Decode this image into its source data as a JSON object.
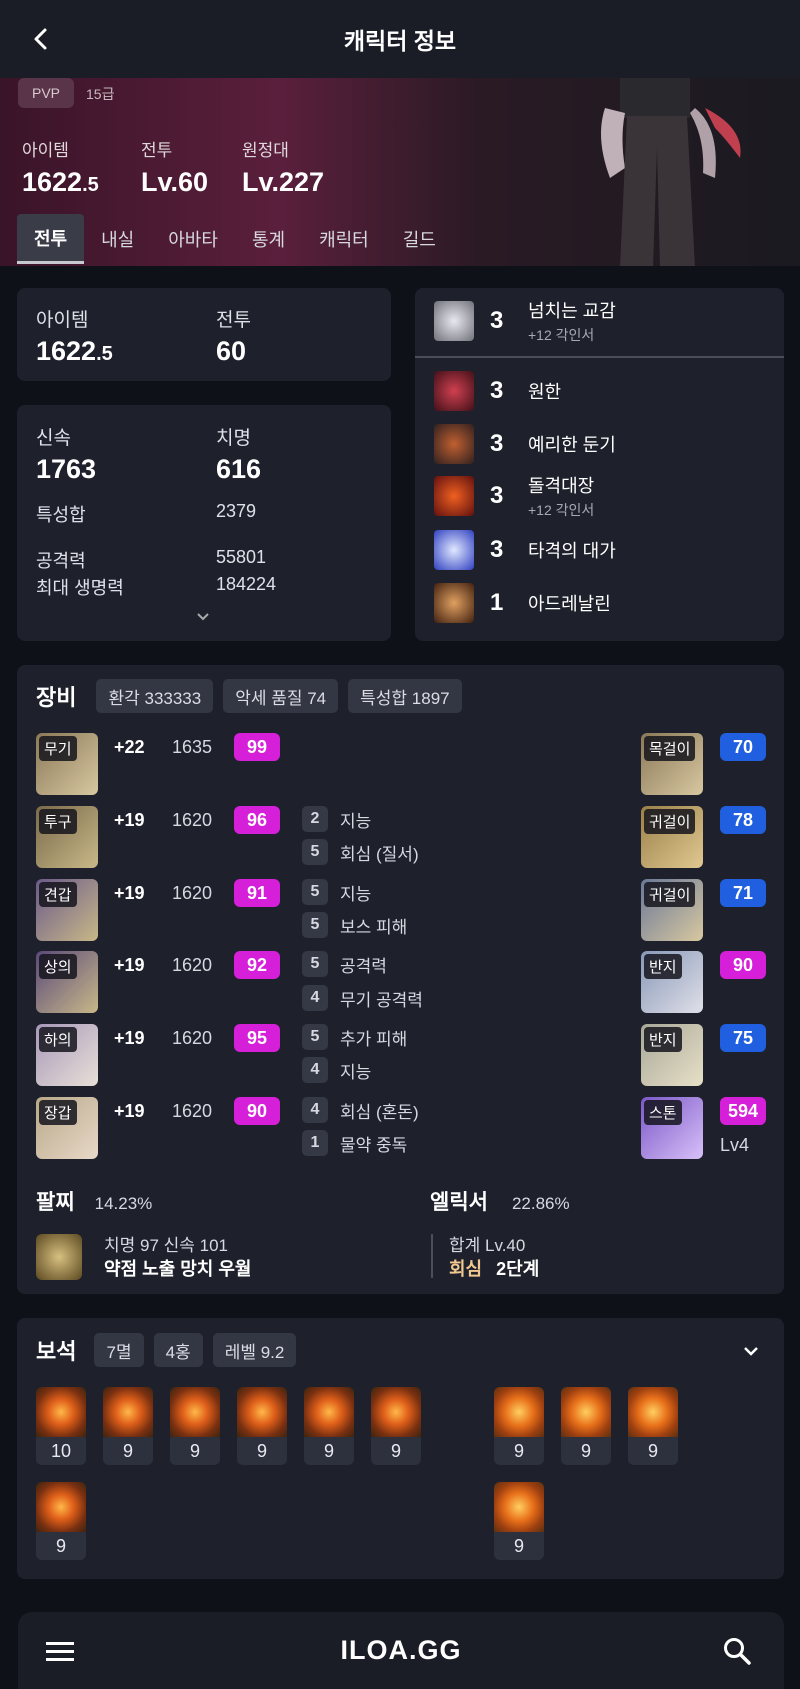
{
  "header": {
    "title": "캐릭터 정보"
  },
  "hero": {
    "pvp_label": "PVP",
    "grade": "15급",
    "stats": [
      {
        "label": "아이템",
        "value_main": "1622",
        "value_small": ".5"
      },
      {
        "label": "전투",
        "value_main": "Lv.60",
        "value_small": ""
      },
      {
        "label": "원정대",
        "value_main": "Lv.227",
        "value_small": ""
      }
    ]
  },
  "tabs": [
    "전투",
    "내실",
    "아바타",
    "통계",
    "캐릭터",
    "길드"
  ],
  "summary": {
    "item_label": "아이템",
    "item_main": "1622",
    "item_small": ".5",
    "combat_label": "전투",
    "combat_value": "60"
  },
  "stats": {
    "swift_label": "신속",
    "swift_value": "1763",
    "crit_label": "치명",
    "crit_value": "616",
    "trait_label": "특성합",
    "trait_value": "2379",
    "atk_label": "공격력",
    "atk_value": "55801",
    "hp_label": "최대 생명력",
    "hp_value": "184224"
  },
  "engravings": [
    {
      "level": "3",
      "name": "넘치는 교감",
      "sub": "+12 각인서",
      "icon": "engraving-icon",
      "color": "#c0c0c8"
    },
    {
      "level": "3",
      "name": "원한",
      "sub": "",
      "icon": "engraving-icon",
      "color": "#a03040"
    },
    {
      "level": "3",
      "name": "예리한 둔기",
      "sub": "",
      "icon": "engraving-icon",
      "color": "#804020"
    },
    {
      "level": "3",
      "name": "돌격대장",
      "sub": "+12 각인서",
      "icon": "engraving-icon",
      "color": "#c04010"
    },
    {
      "level": "3",
      "name": "타격의 대가",
      "sub": "",
      "icon": "engraving-icon",
      "color": "#4050e0"
    },
    {
      "level": "1",
      "name": "아드레날린",
      "sub": "",
      "icon": "engraving-icon",
      "color": "#a06030"
    }
  ],
  "equipment": {
    "title": "장비",
    "chips": [
      "환각 333333",
      "악세 품질 74",
      "특성합 1897"
    ],
    "items": [
      {
        "slot": "무기",
        "plus": "+22",
        "level": "1635",
        "quality": "99",
        "opts": []
      },
      {
        "slot": "투구",
        "plus": "+19",
        "level": "1620",
        "quality": "96",
        "opts": [
          {
            "n": "2",
            "t": "지능"
          },
          {
            "n": "5",
            "t": "회심 (질서)"
          }
        ]
      },
      {
        "slot": "견갑",
        "plus": "+19",
        "level": "1620",
        "quality": "91",
        "opts": [
          {
            "n": "5",
            "t": "지능"
          },
          {
            "n": "5",
            "t": "보스 피해"
          }
        ]
      },
      {
        "slot": "상의",
        "plus": "+19",
        "level": "1620",
        "quality": "92",
        "opts": [
          {
            "n": "5",
            "t": "공격력"
          },
          {
            "n": "4",
            "t": "무기 공격력"
          }
        ]
      },
      {
        "slot": "하의",
        "plus": "+19",
        "level": "1620",
        "quality": "95",
        "opts": [
          {
            "n": "5",
            "t": "추가 피해"
          },
          {
            "n": "4",
            "t": "지능"
          }
        ]
      },
      {
        "slot": "장갑",
        "plus": "+19",
        "level": "1620",
        "quality": "90",
        "opts": [
          {
            "n": "4",
            "t": "회심 (혼돈)"
          },
          {
            "n": "1",
            "t": "물약 중독"
          }
        ]
      }
    ],
    "accessories": [
      {
        "slot": "목걸이",
        "quality": "70",
        "color": "blue"
      },
      {
        "slot": "귀걸이",
        "quality": "78",
        "color": "blue"
      },
      {
        "slot": "귀걸이",
        "quality": "71",
        "color": "blue"
      },
      {
        "slot": "반지",
        "quality": "90",
        "color": "mag"
      },
      {
        "slot": "반지",
        "quality": "75",
        "color": "blue"
      },
      {
        "slot": "스톤",
        "quality": "594",
        "color": "mag",
        "extra": "Lv4"
      }
    ],
    "bracelet": {
      "title": "팔찌",
      "pct": "14.23%",
      "line1": "치명 97  신속 101",
      "line2": "약점 노출  망치  우월"
    },
    "elixir": {
      "title": "엘릭서",
      "pct": "22.86%",
      "line1": "합계 Lv.40",
      "line2a": "회심",
      "line2b": "2단계"
    }
  },
  "gems": {
    "title": "보석",
    "chips": [
      "7멸",
      "4홍",
      "레벨 9.2"
    ],
    "left": [
      "10",
      "9",
      "9",
      "9",
      "9",
      "9",
      "9"
    ],
    "right": [
      "9",
      "9",
      "9",
      "9"
    ]
  },
  "footer": {
    "logo": "ILOA.GG"
  }
}
